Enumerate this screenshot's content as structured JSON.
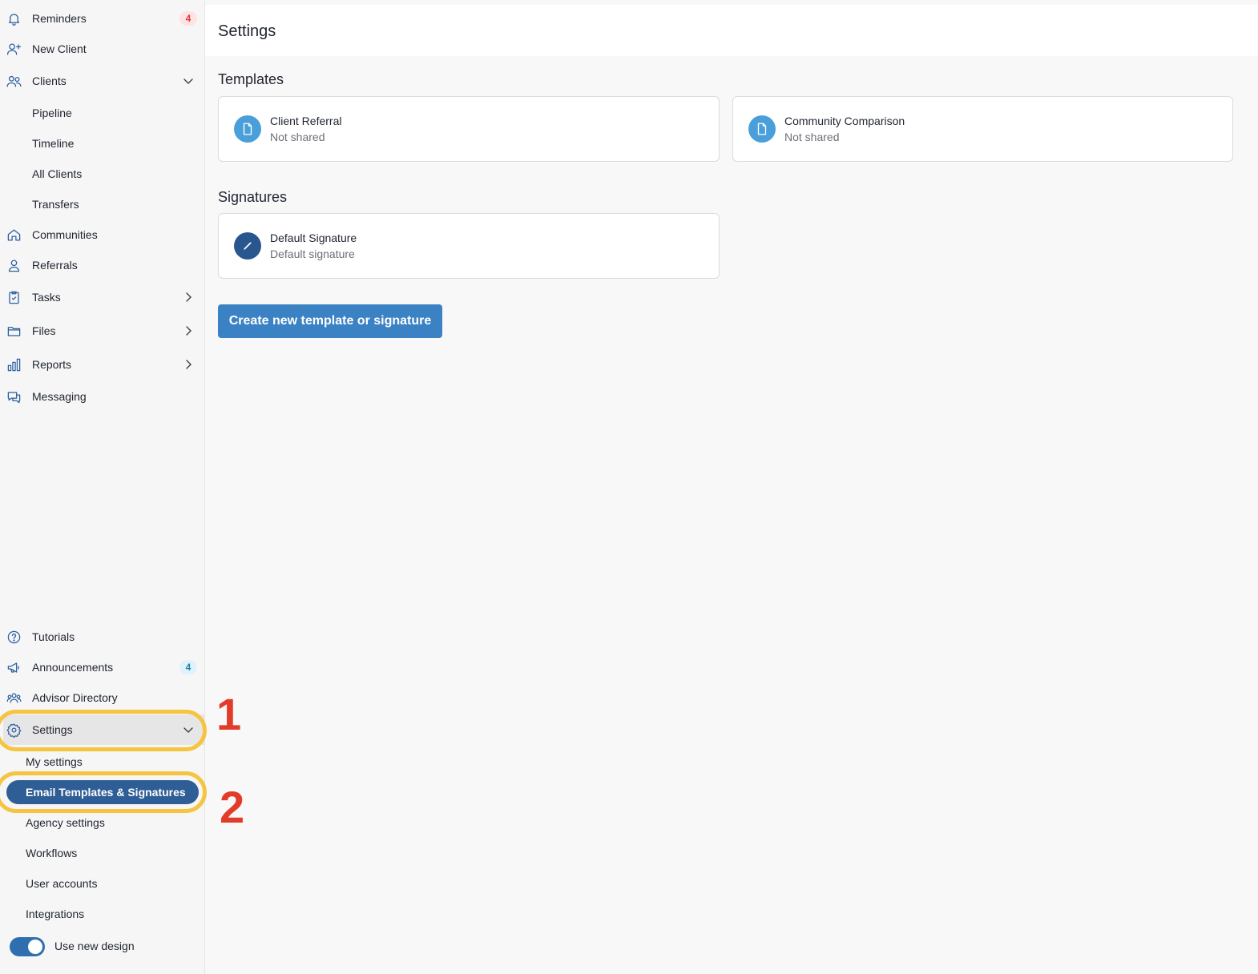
{
  "sidebar": {
    "items": {
      "reminders": {
        "label": "Reminders",
        "badge": "4"
      },
      "new_client": {
        "label": "New Client"
      },
      "clients": {
        "label": "Clients"
      },
      "pipeline": {
        "label": "Pipeline"
      },
      "timeline": {
        "label": "Timeline"
      },
      "all_clients": {
        "label": "All Clients"
      },
      "transfers": {
        "label": "Transfers"
      },
      "communities": {
        "label": "Communities"
      },
      "referrals": {
        "label": "Referrals"
      },
      "tasks": {
        "label": "Tasks"
      },
      "files": {
        "label": "Files"
      },
      "reports": {
        "label": "Reports"
      },
      "messaging": {
        "label": "Messaging"
      },
      "tutorials": {
        "label": "Tutorials"
      },
      "announcements": {
        "label": "Announcements",
        "badge": "4"
      },
      "advisor_directory": {
        "label": "Advisor Directory"
      },
      "settings": {
        "label": "Settings"
      },
      "my_settings": {
        "label": "My settings"
      },
      "email_templates": {
        "label": "Email Templates & Signatures"
      },
      "agency_settings": {
        "label": "Agency settings"
      },
      "workflows": {
        "label": "Workflows"
      },
      "user_accounts": {
        "label": "User accounts"
      },
      "integrations": {
        "label": "Integrations"
      }
    },
    "toggle": {
      "label": "Use new design",
      "on": true
    }
  },
  "annotations": {
    "one": "1",
    "two": "2"
  },
  "main": {
    "title": "Settings",
    "templates": {
      "heading": "Templates",
      "cards": [
        {
          "title": "Client Referral",
          "status": "Not shared",
          "icon": "document-icon"
        },
        {
          "title": "Community Comparison",
          "status": "Not shared",
          "icon": "document-icon"
        }
      ]
    },
    "signatures": {
      "heading": "Signatures",
      "cards": [
        {
          "title": "Default Signature",
          "status": "Default signature",
          "icon": "pencil-icon"
        }
      ]
    },
    "create_button": "Create new template or signature"
  },
  "colors": {
    "accent": "#3b82c4",
    "active_nav": "#2f5d95",
    "annotation_ring": "#f5c542",
    "annotation_number": "#e33b2a"
  }
}
